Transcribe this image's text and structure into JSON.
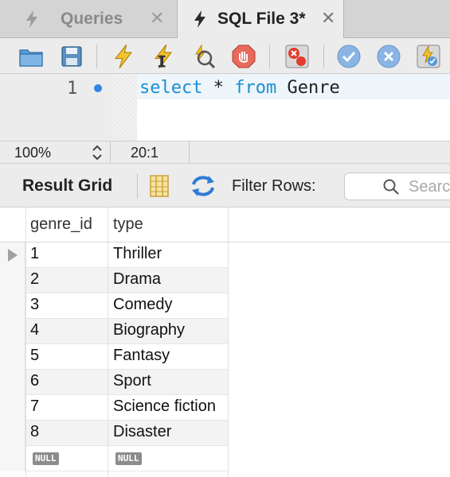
{
  "tabs": [
    {
      "label": "Queries",
      "active": false,
      "icon": "lightning-bolt-icon",
      "close": "✕"
    },
    {
      "label": "SQL File 3*",
      "active": true,
      "icon": "lightning-bolt-icon",
      "close": "✕"
    }
  ],
  "toolbar": {
    "buttons": [
      "open-folder-icon",
      "save-icon",
      "execute-icon",
      "execute-current-icon",
      "explain-icon",
      "stop-icon",
      "toggle-stop-on-error-icon",
      "commit-icon",
      "rollback-icon",
      "autocommit-icon"
    ]
  },
  "editor": {
    "line_number": "1",
    "code": {
      "kw1": "select",
      "mid": " * ",
      "kw2": "from",
      "rest": " Genre"
    }
  },
  "status": {
    "zoom": "100%",
    "cursor": "20:1"
  },
  "results": {
    "title": "Result Grid",
    "filter_label": "Filter Rows:",
    "search_placeholder": "Search"
  },
  "grid": {
    "columns": [
      "genre_id",
      "type"
    ],
    "rows": [
      {
        "genre_id": "1",
        "type": "Thriller"
      },
      {
        "genre_id": "2",
        "type": "Drama"
      },
      {
        "genre_id": "3",
        "type": "Comedy"
      },
      {
        "genre_id": "4",
        "type": "Biography"
      },
      {
        "genre_id": "5",
        "type": "Fantasy"
      },
      {
        "genre_id": "6",
        "type": "Sport"
      },
      {
        "genre_id": "7",
        "type": "Science fiction"
      },
      {
        "genre_id": "8",
        "type": "Disaster"
      }
    ],
    "null_label": "NULL"
  },
  "colors": {
    "keyword": "#1a8fd0",
    "accent": "#2f86e6"
  }
}
